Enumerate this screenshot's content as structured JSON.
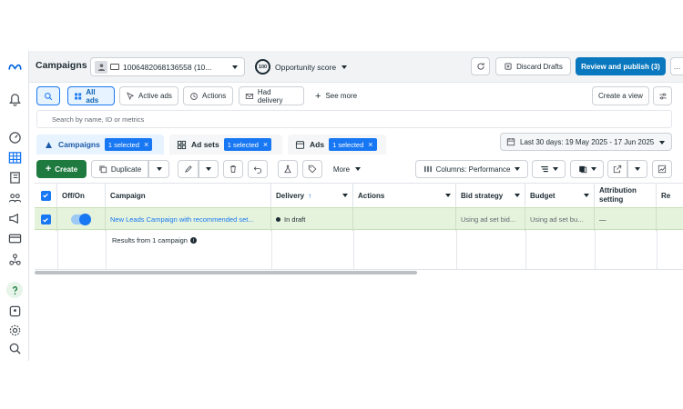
{
  "header": {
    "title": "Campaigns",
    "account_name": "1006482068136558 (10...",
    "opportunity_score_value": "100",
    "opportunity_score_label": "Opportunity score",
    "discard_label": "Discard Drafts",
    "publish_label": "Review and publish (3)"
  },
  "filters": {
    "all_ads": "All ads",
    "active_ads": "Active ads",
    "actions": "Actions",
    "had_delivery": "Had delivery",
    "see_more": "See more",
    "create_view": "Create a view"
  },
  "search": {
    "placeholder": "Search by name, ID or metrics"
  },
  "tabs": [
    {
      "label": "Campaigns",
      "badge": "1 selected"
    },
    {
      "label": "Ad sets",
      "badge": "1 selected"
    },
    {
      "label": "Ads",
      "badge": "1 selected"
    }
  ],
  "date_range": "Last 30 days: 19 May 2025 - 17 Jun 2025",
  "toolbar": {
    "create": "Create",
    "duplicate": "Duplicate",
    "more": "More",
    "columns": "Columns: Performance"
  },
  "table": {
    "headers": {
      "off_on": "Off/On",
      "campaign": "Campaign",
      "delivery": "Delivery",
      "actions": "Actions",
      "bid_strategy": "Bid strategy",
      "budget": "Budget",
      "attribution": "Attribution setting",
      "results": "Re"
    },
    "row": {
      "campaign": "New Leads Campaign with recommended set...",
      "delivery": "In draft",
      "bid_strategy": "Using ad set bid...",
      "budget": "Using ad set bu...",
      "attribution": "—"
    },
    "results_text": "Results from 1 campaign"
  },
  "colors": {
    "primary": "#0a78be",
    "create": "#1e7a3e",
    "selected_row": "#e5f3dc",
    "accent": "#1877f2"
  }
}
